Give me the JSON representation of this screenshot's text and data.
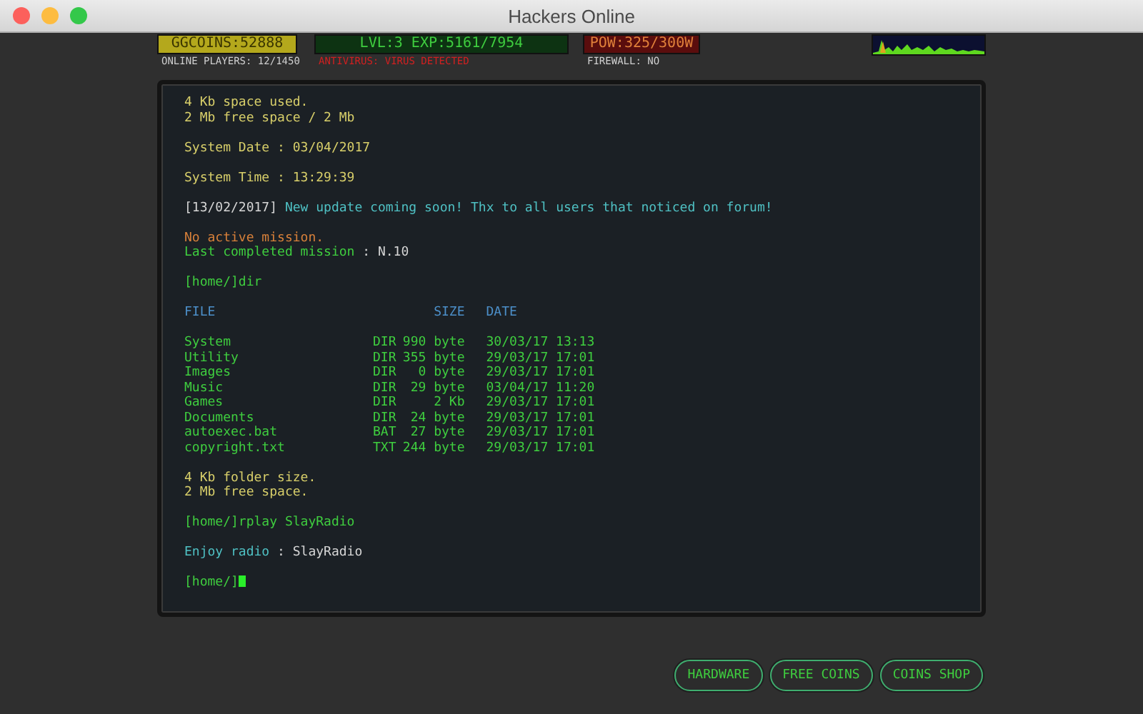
{
  "window": {
    "title": "Hackers Online"
  },
  "status": {
    "coins": "GGCOINS:52888",
    "players": "ONLINE PLAYERS: 12/1450",
    "level": "LVL:3  EXP:5161/7954",
    "antivirus": "ANTIVIRUS: VIRUS DETECTED",
    "power": "POW:325/300W",
    "firewall": "FIREWALL: NO"
  },
  "terminal": {
    "blocks": [
      [
        [
          {
            "text": "4 Kb space used.",
            "kind": "yellow"
          }
        ],
        [
          {
            "text": "2 Mb free space / 2 Mb",
            "kind": "yellow"
          }
        ]
      ],
      [
        [
          {
            "text": "System Date : 03/04/2017",
            "kind": "yellow"
          }
        ]
      ],
      [
        [
          {
            "text": "System Time : 13:29:39",
            "kind": "yellow"
          }
        ]
      ],
      [
        [
          {
            "text": "[13/02/2017]",
            "kind": "white"
          },
          {
            "text": " New update coming soon! Thx to all users that noticed on forum!",
            "kind": "cyan"
          }
        ]
      ],
      [
        [
          {
            "text": "No active mission.",
            "kind": "orange"
          }
        ],
        [
          {
            "text": "Last completed mission",
            "kind": "green"
          },
          {
            "text": " : N.10",
            "kind": "white"
          }
        ]
      ],
      [
        [
          {
            "text": "[home/]dir",
            "kind": "green"
          }
        ]
      ]
    ],
    "listing": {
      "columns": [
        "FILE",
        "SIZE",
        "DATE"
      ],
      "rows": [
        {
          "name": "System",
          "type": "DIR",
          "size": "990 byte",
          "date": "30/03/17 13:13"
        },
        {
          "name": "Utility",
          "type": "DIR",
          "size": "355 byte",
          "date": "29/03/17 17:01"
        },
        {
          "name": "Images",
          "type": "DIR",
          "size": "0 byte",
          "date": "29/03/17 17:01"
        },
        {
          "name": "Music",
          "type": "DIR",
          "size": "29 byte",
          "date": "03/04/17 11:20"
        },
        {
          "name": "Games",
          "type": "DIR",
          "size": "2 Kb",
          "date": "29/03/17 17:01"
        },
        {
          "name": "Documents",
          "type": "DIR",
          "size": "24 byte",
          "date": "29/03/17 17:01"
        },
        {
          "name": "autoexec.bat",
          "type": "BAT",
          "size": "27 byte",
          "date": "29/03/17 17:01"
        },
        {
          "name": "copyright.txt",
          "type": "TXT",
          "size": "244 byte",
          "date": "29/03/17 17:01"
        }
      ]
    },
    "after": [
      [
        [
          {
            "text": "4 Kb folder size.",
            "kind": "yellow"
          }
        ],
        [
          {
            "text": "2 Mb free space.",
            "kind": "yellow"
          }
        ]
      ],
      [
        [
          {
            "text": "[home/]rplay SlayRadio",
            "kind": "green"
          }
        ]
      ],
      [
        [
          {
            "text": "Enjoy radio",
            "kind": "cyan"
          },
          {
            "text": " : SlayRadio",
            "kind": "white"
          }
        ]
      ]
    ],
    "prompt": "[home/]"
  },
  "buttons": [
    "HARDWARE",
    "FREE COINS",
    "COINS SHOP"
  ]
}
